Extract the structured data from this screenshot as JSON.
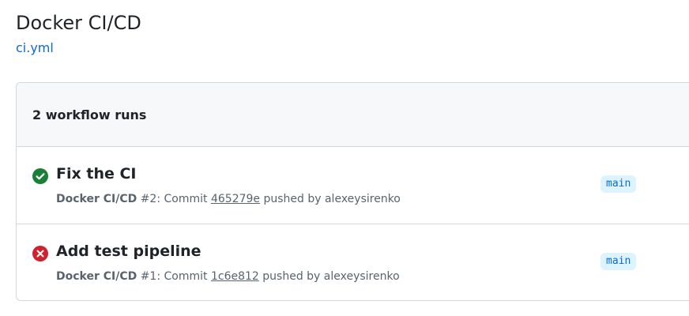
{
  "workflow": {
    "title": "Docker CI/CD",
    "file": "ci.yml"
  },
  "runs_header": {
    "count_label": "2 workflow runs"
  },
  "runs": [
    {
      "status": "success",
      "status_icon": "check-circle-icon",
      "status_color": "#1a7f37",
      "title": "Fix the CI",
      "workflow_name": "Docker CI/CD",
      "run_number": "#2",
      "commit_prefix": ": Commit ",
      "commit_sha": "465279e",
      "pushed_by": " pushed by alexeysirenko",
      "branch": "main"
    },
    {
      "status": "failure",
      "status_icon": "x-circle-icon",
      "status_color": "#cf222e",
      "title": "Add test pipeline",
      "workflow_name": "Docker CI/CD",
      "run_number": "#1",
      "commit_prefix": ": Commit ",
      "commit_sha": "1c6e812",
      "pushed_by": " pushed by alexeysirenko",
      "branch": "main"
    }
  ]
}
